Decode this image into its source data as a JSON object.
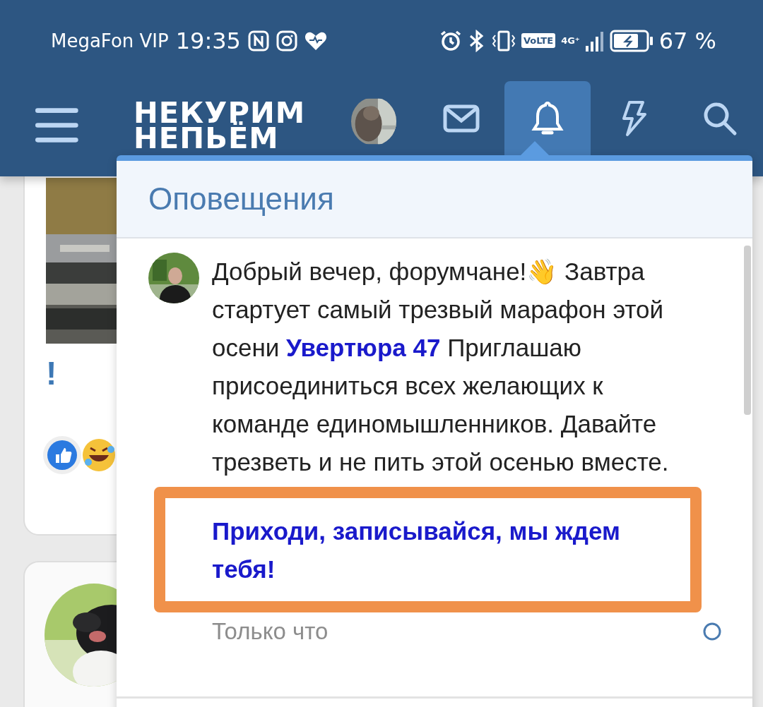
{
  "status_bar": {
    "carrier": "MegaFon VIP",
    "time": "19:35",
    "volte": "VoLTE",
    "network": "4G⁺",
    "battery": "67 %"
  },
  "header": {
    "logo_lines": [
      "НЕКУРИМ",
      "НЕПЬЁМ"
    ]
  },
  "nav": {
    "tabs": [
      {
        "kind": "mail",
        "selected": false
      },
      {
        "kind": "bell",
        "selected": true
      },
      {
        "kind": "bolt",
        "selected": false
      },
      {
        "kind": "search",
        "selected": false
      }
    ]
  },
  "feed": {
    "mark": "!"
  },
  "notifications": {
    "title": "Оповещения",
    "items": [
      {
        "parts": [
          {
            "kind": "text",
            "text": "Добрый вечер, форумчане!👋 Завтра стартует самый трезвый марафон этой осени "
          },
          {
            "kind": "link",
            "text": "Увертюра 47"
          },
          {
            "kind": "text",
            "text": " Приглашаю присоединиться всех желающих к команде единомышленников. Давайте трезветь и не пить этой осенью вместе."
          }
        ],
        "call_to_action": "Приходи, записывайся, мы ждем тебя!",
        "highlighted": true,
        "time": "Только что"
      }
    ]
  }
}
